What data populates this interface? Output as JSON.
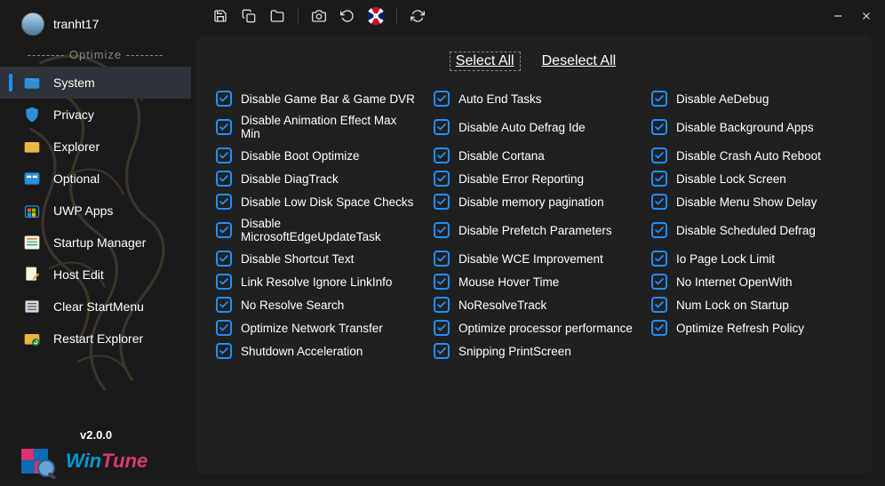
{
  "user": {
    "name": "tranht17"
  },
  "sidebar": {
    "section": "-------- Optimize --------",
    "items": [
      {
        "label": "System",
        "icon": "folder-blue",
        "active": true
      },
      {
        "label": "Privacy",
        "icon": "shield-blue",
        "active": false
      },
      {
        "label": "Explorer",
        "icon": "folder-yellow",
        "active": false
      },
      {
        "label": "Optional",
        "icon": "panel-blue",
        "active": false
      },
      {
        "label": "UWP Apps",
        "icon": "store-colored",
        "active": false
      },
      {
        "label": "Startup Manager",
        "icon": "list-colored",
        "active": false
      },
      {
        "label": "Host Edit",
        "icon": "edit-doc",
        "active": false
      },
      {
        "label": "Clear StartMenu",
        "icon": "menu-list",
        "active": false
      },
      {
        "label": "Restart Explorer",
        "icon": "folder-refresh",
        "active": false
      }
    ]
  },
  "footer": {
    "version": "v2.0.0",
    "brand": "WinTune"
  },
  "toolbar": {
    "save": "save-icon",
    "copy": "copy-icon",
    "open": "open-folder-icon",
    "camera": "camera-icon",
    "undo": "undo-icon",
    "lang": "flag-uk-icon",
    "refresh": "refresh-icon",
    "minimize": "minimize-icon",
    "close": "close-icon"
  },
  "actions": {
    "select_all": "Select All",
    "deselect_all": "Deselect All"
  },
  "options": {
    "col1": [
      "Disable Game Bar & Game DVR",
      "Disable Animation Effect Max Min",
      "Disable Boot Optimize",
      "Disable DiagTrack",
      "Disable Low Disk Space Checks",
      "Disable MicrosoftEdgeUpdateTask",
      "Disable Shortcut Text",
      "Link Resolve Ignore LinkInfo",
      "No Resolve Search",
      "Optimize Network Transfer",
      "Shutdown Acceleration"
    ],
    "col2": [
      "Auto End Tasks",
      "Disable Auto Defrag Ide",
      "Disable Cortana",
      "Disable Error Reporting",
      "Disable memory pagination",
      "Disable Prefetch Parameters",
      "Disable WCE Improvement",
      "Mouse Hover Time",
      "NoResolveTrack",
      "Optimize processor performance",
      "Snipping PrintScreen"
    ],
    "col3": [
      "Disable AeDebug",
      "Disable Background Apps",
      "Disable Crash Auto Reboot",
      "Disable Lock Screen",
      "Disable Menu Show Delay",
      "Disable Scheduled Defrag",
      "Io Page Lock Limit",
      "No Internet OpenWith",
      "Num Lock on Startup",
      "Optimize Refresh Policy"
    ]
  }
}
